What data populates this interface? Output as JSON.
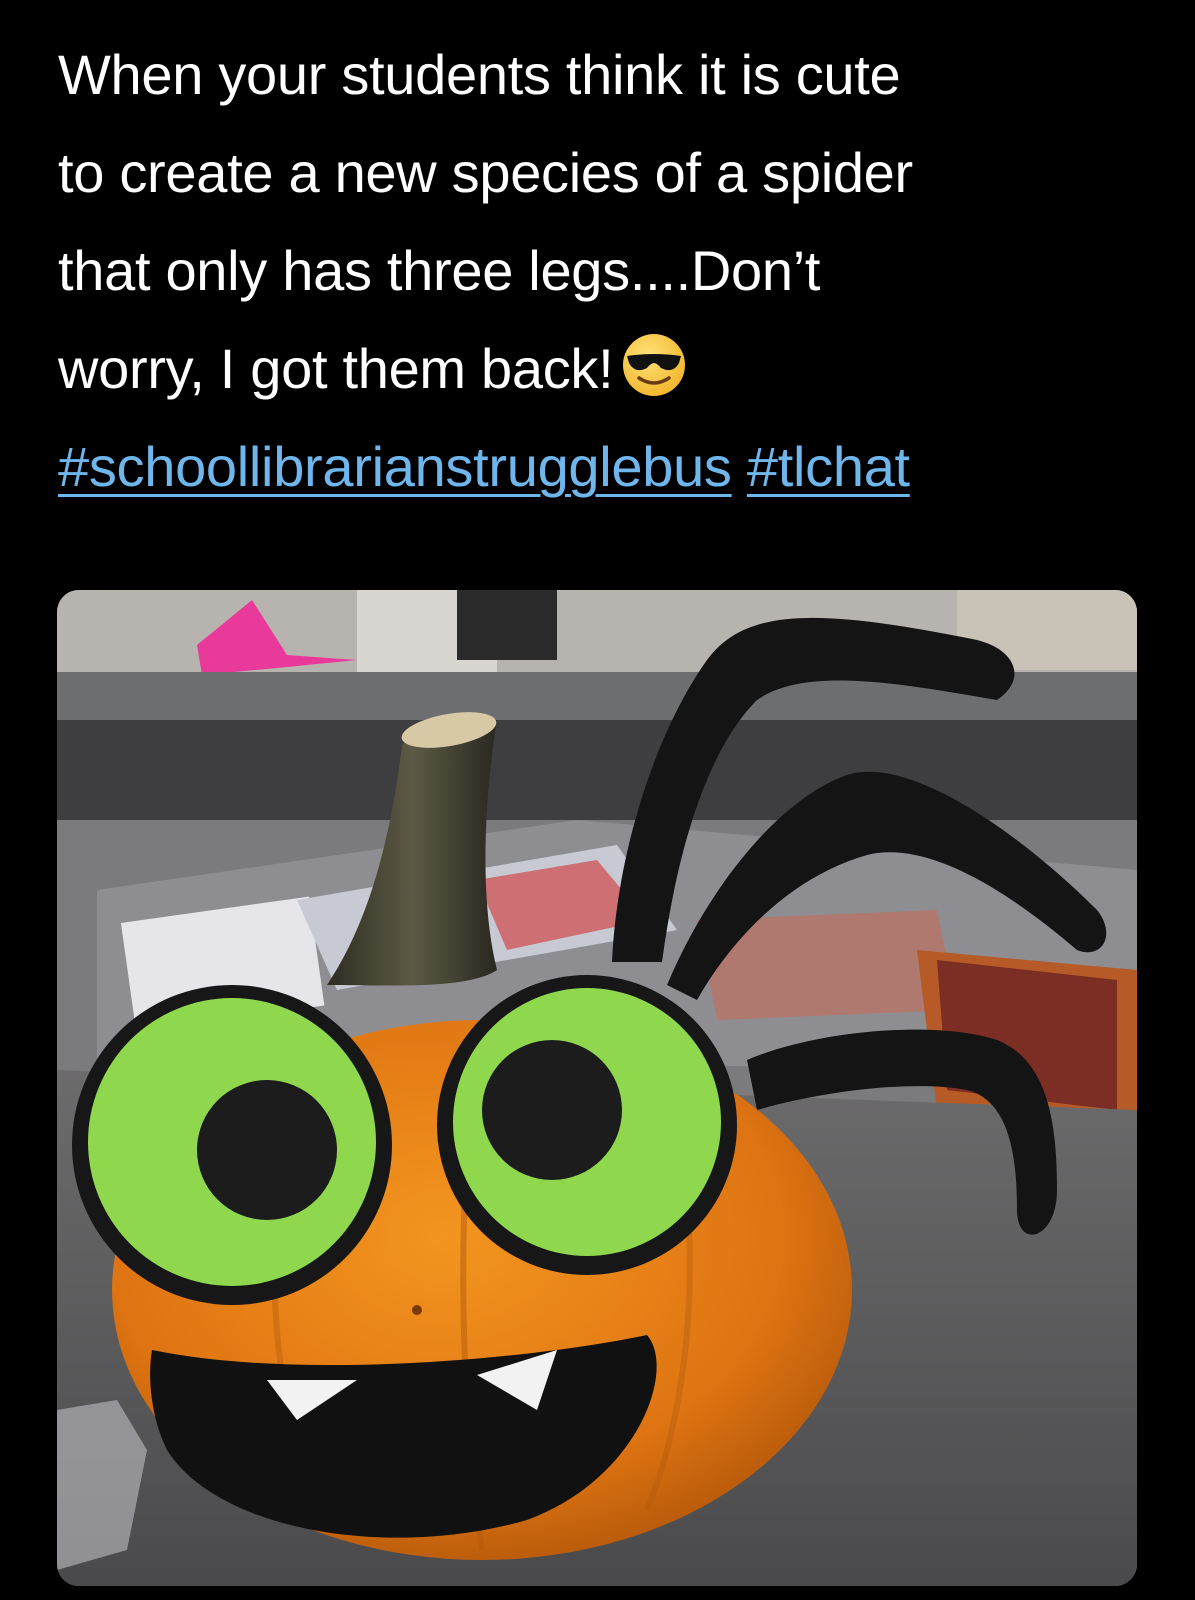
{
  "tweet": {
    "lines": [
      "When your students think it is cute",
      "to create a new species of a spider",
      "that only has three legs....Don’t",
      "worry, I got them back!"
    ],
    "emoji": "smiling-face-with-sunglasses-icon",
    "hashtags": [
      "#schoollibrarianstrugglebus",
      "#tlchat"
    ]
  },
  "media": {
    "icon": "pumpkin-spider-photo",
    "colors": {
      "pumpkin": "#e07a16",
      "eye_green": "#8fd84e",
      "legs": "#111111",
      "background_table": "#58595b"
    }
  }
}
